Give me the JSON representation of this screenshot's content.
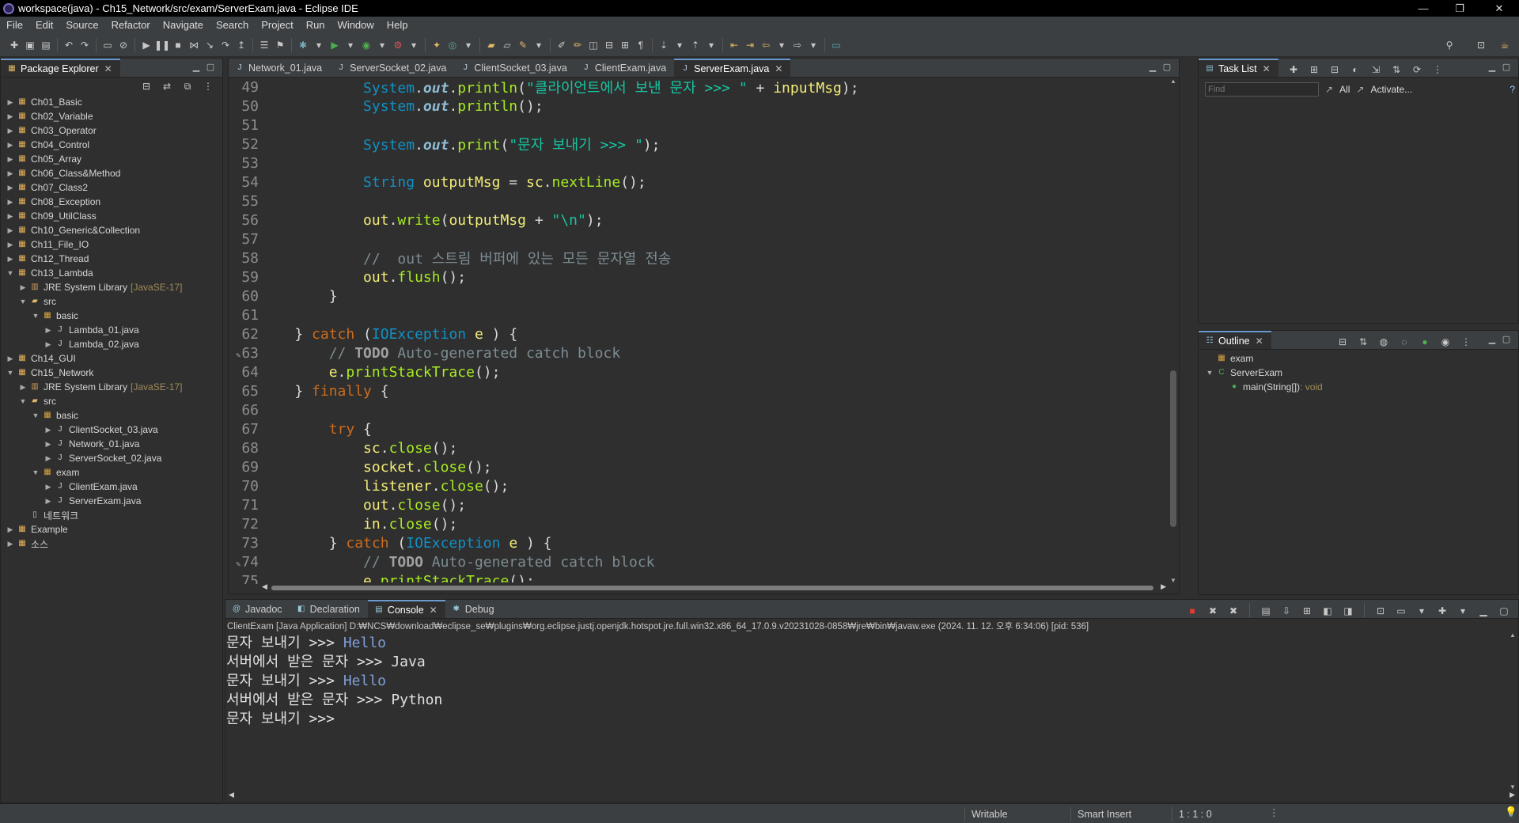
{
  "window": {
    "title": "workspace(java) - Ch15_Network/src/exam/ServerExam.java - Eclipse IDE",
    "minimize": "—",
    "restore": "❐",
    "close": "✕"
  },
  "menu": [
    "File",
    "Edit",
    "Source",
    "Refactor",
    "Navigate",
    "Search",
    "Project",
    "Run",
    "Window",
    "Help"
  ],
  "package_explorer": {
    "tab": "Package Explorer",
    "tree": [
      {
        "label": "Ch01_Basic",
        "level": 0,
        "type": "project",
        "expanded": false
      },
      {
        "label": "Ch02_Variable",
        "level": 0,
        "type": "project",
        "expanded": false
      },
      {
        "label": "Ch03_Operator",
        "level": 0,
        "type": "project",
        "expanded": false
      },
      {
        "label": "Ch04_Control",
        "level": 0,
        "type": "project",
        "expanded": false
      },
      {
        "label": "Ch05_Array",
        "level": 0,
        "type": "project",
        "expanded": false
      },
      {
        "label": "Ch06_Class&Method",
        "level": 0,
        "type": "project",
        "expanded": false
      },
      {
        "label": "Ch07_Class2",
        "level": 0,
        "type": "project",
        "expanded": false
      },
      {
        "label": "Ch08_Exception",
        "level": 0,
        "type": "project",
        "expanded": false
      },
      {
        "label": "Ch09_UtilClass",
        "level": 0,
        "type": "project",
        "expanded": false
      },
      {
        "label": "Ch10_Generic&Collection",
        "level": 0,
        "type": "project",
        "expanded": false
      },
      {
        "label": "Ch11_File_IO",
        "level": 0,
        "type": "project",
        "expanded": false
      },
      {
        "label": "Ch12_Thread",
        "level": 0,
        "type": "project",
        "expanded": false
      },
      {
        "label": "Ch13_Lambda",
        "level": 0,
        "type": "project",
        "expanded": true
      },
      {
        "label": "JRE System Library",
        "suffix": "[JavaSE-17]",
        "level": 1,
        "type": "library",
        "expanded": false
      },
      {
        "label": "src",
        "level": 1,
        "type": "folder",
        "expanded": true
      },
      {
        "label": "basic",
        "level": 2,
        "type": "package",
        "expanded": true
      },
      {
        "label": "Lambda_01.java",
        "level": 3,
        "type": "java",
        "expanded": false
      },
      {
        "label": "Lambda_02.java",
        "level": 3,
        "type": "java",
        "expanded": false
      },
      {
        "label": "Ch14_GUI",
        "level": 0,
        "type": "project",
        "expanded": false
      },
      {
        "label": "Ch15_Network",
        "level": 0,
        "type": "project",
        "expanded": true
      },
      {
        "label": "JRE System Library",
        "suffix": "[JavaSE-17]",
        "level": 1,
        "type": "library",
        "expanded": false
      },
      {
        "label": "src",
        "level": 1,
        "type": "folder",
        "expanded": true
      },
      {
        "label": "basic",
        "level": 2,
        "type": "package",
        "expanded": true
      },
      {
        "label": "ClientSocket_03.java",
        "level": 3,
        "type": "java",
        "expanded": false
      },
      {
        "label": "Network_01.java",
        "level": 3,
        "type": "java",
        "expanded": false
      },
      {
        "label": "ServerSocket_02.java",
        "level": 3,
        "type": "java",
        "expanded": false
      },
      {
        "label": "exam",
        "level": 2,
        "type": "package",
        "expanded": true
      },
      {
        "label": "ClientExam.java",
        "level": 3,
        "type": "java",
        "expanded": false
      },
      {
        "label": "ServerExam.java",
        "level": 3,
        "type": "java",
        "expanded": false
      },
      {
        "label": "네트워크",
        "level": 1,
        "type": "file",
        "expanded": null
      },
      {
        "label": "Example",
        "level": 0,
        "type": "project",
        "expanded": false
      },
      {
        "label": "소스",
        "level": 0,
        "type": "project",
        "expanded": false
      }
    ]
  },
  "editor": {
    "tabs": [
      {
        "label": "Network_01.java",
        "active": false
      },
      {
        "label": "ServerSocket_02.java",
        "active": false
      },
      {
        "label": "ClientSocket_03.java",
        "active": false
      },
      {
        "label": "ClientExam.java",
        "active": false
      },
      {
        "label": "ServerExam.java",
        "active": true
      }
    ],
    "lines": [
      {
        "n": "49",
        "tokens": [
          [
            "",
            "            "
          ],
          [
            "t",
            "System"
          ],
          [
            "",
            "."
          ],
          [
            "f",
            "out"
          ],
          [
            "",
            "."
          ],
          [
            "m",
            "println"
          ],
          [
            "",
            "("
          ],
          [
            "s",
            "\"클라이언트에서 보낸 문자 >>> \""
          ],
          [
            "",
            " + "
          ],
          [
            "v",
            "inputMsg"
          ],
          [
            "",
            ");"
          ]
        ]
      },
      {
        "n": "50",
        "tokens": [
          [
            "",
            "            "
          ],
          [
            "t",
            "System"
          ],
          [
            "",
            "."
          ],
          [
            "f",
            "out"
          ],
          [
            "",
            "."
          ],
          [
            "m",
            "println"
          ],
          [
            "",
            "();"
          ]
        ]
      },
      {
        "n": "51",
        "tokens": []
      },
      {
        "n": "52",
        "tokens": [
          [
            "",
            "            "
          ],
          [
            "t",
            "System"
          ],
          [
            "",
            "."
          ],
          [
            "f",
            "out"
          ],
          [
            "",
            "."
          ],
          [
            "m",
            "print"
          ],
          [
            "",
            "("
          ],
          [
            "s",
            "\"문자 보내기 >>> \""
          ],
          [
            "",
            ");"
          ]
        ]
      },
      {
        "n": "53",
        "tokens": []
      },
      {
        "n": "54",
        "tokens": [
          [
            "",
            "            "
          ],
          [
            "t",
            "String"
          ],
          [
            "",
            " "
          ],
          [
            "v",
            "outputMsg"
          ],
          [
            "",
            " = "
          ],
          [
            "v",
            "sc"
          ],
          [
            "",
            "."
          ],
          [
            "m",
            "nextLine"
          ],
          [
            "",
            "();"
          ]
        ]
      },
      {
        "n": "55",
        "tokens": []
      },
      {
        "n": "56",
        "tokens": [
          [
            "",
            "            "
          ],
          [
            "v",
            "out"
          ],
          [
            "",
            "."
          ],
          [
            "m",
            "write"
          ],
          [
            "",
            "("
          ],
          [
            "v",
            "outputMsg"
          ],
          [
            "",
            " + "
          ],
          [
            "s",
            "\"\\n\""
          ],
          [
            "",
            ");"
          ]
        ]
      },
      {
        "n": "57",
        "tokens": []
      },
      {
        "n": "58",
        "tokens": [
          [
            "",
            "            "
          ],
          [
            "c",
            "//  out 스트림 버퍼에 있는 모든 문자열 전송"
          ]
        ]
      },
      {
        "n": "59",
        "tokens": [
          [
            "",
            "            "
          ],
          [
            "v",
            "out"
          ],
          [
            "",
            "."
          ],
          [
            "m",
            "flush"
          ],
          [
            "",
            "();"
          ]
        ]
      },
      {
        "n": "60",
        "tokens": [
          [
            "",
            "        }"
          ]
        ]
      },
      {
        "n": "61",
        "tokens": []
      },
      {
        "n": "62",
        "tokens": [
          [
            "",
            "    } "
          ],
          [
            "k",
            "catch"
          ],
          [
            "",
            " ("
          ],
          [
            "t",
            "IOException"
          ],
          [
            "",
            " "
          ],
          [
            "v",
            "e"
          ],
          [
            "",
            " ) {"
          ]
        ]
      },
      {
        "n": "63",
        "marker": true,
        "tokens": [
          [
            "",
            "        "
          ],
          [
            "c",
            "// "
          ],
          [
            "kb",
            "TODO"
          ],
          [
            "c",
            " Auto-generated catch block"
          ]
        ]
      },
      {
        "n": "64",
        "tokens": [
          [
            "",
            "        "
          ],
          [
            "v",
            "e"
          ],
          [
            "",
            "."
          ],
          [
            "m",
            "printStackTrace"
          ],
          [
            "",
            "();"
          ]
        ]
      },
      {
        "n": "65",
        "tokens": [
          [
            "",
            "    } "
          ],
          [
            "k",
            "finally"
          ],
          [
            "",
            " {"
          ]
        ]
      },
      {
        "n": "66",
        "tokens": []
      },
      {
        "n": "67",
        "tokens": [
          [
            "",
            "        "
          ],
          [
            "k",
            "try"
          ],
          [
            "",
            " {"
          ]
        ]
      },
      {
        "n": "68",
        "tokens": [
          [
            "",
            "            "
          ],
          [
            "v",
            "sc"
          ],
          [
            "",
            "."
          ],
          [
            "m",
            "close"
          ],
          [
            "",
            "();"
          ]
        ]
      },
      {
        "n": "69",
        "tokens": [
          [
            "",
            "            "
          ],
          [
            "v",
            "socket"
          ],
          [
            "",
            "."
          ],
          [
            "m",
            "close"
          ],
          [
            "",
            "();"
          ]
        ]
      },
      {
        "n": "70",
        "tokens": [
          [
            "",
            "            "
          ],
          [
            "v",
            "listener"
          ],
          [
            "",
            "."
          ],
          [
            "m",
            "close"
          ],
          [
            "",
            "();"
          ]
        ]
      },
      {
        "n": "71",
        "tokens": [
          [
            "",
            "            "
          ],
          [
            "v",
            "out"
          ],
          [
            "",
            "."
          ],
          [
            "m",
            "close"
          ],
          [
            "",
            "();"
          ]
        ]
      },
      {
        "n": "72",
        "tokens": [
          [
            "",
            "            "
          ],
          [
            "v",
            "in"
          ],
          [
            "",
            "."
          ],
          [
            "m",
            "close"
          ],
          [
            "",
            "();"
          ]
        ]
      },
      {
        "n": "73",
        "tokens": [
          [
            "",
            "        } "
          ],
          [
            "k",
            "catch"
          ],
          [
            "",
            " ("
          ],
          [
            "t",
            "IOException"
          ],
          [
            "",
            " "
          ],
          [
            "v",
            "e"
          ],
          [
            "",
            " ) {"
          ]
        ]
      },
      {
        "n": "74",
        "marker": true,
        "tokens": [
          [
            "",
            "            "
          ],
          [
            "c",
            "// "
          ],
          [
            "kb",
            "TODO"
          ],
          [
            "c",
            " Auto-generated catch block"
          ]
        ]
      },
      {
        "n": "75",
        "tokens": [
          [
            "",
            "            "
          ],
          [
            "v",
            "e"
          ],
          [
            "",
            "."
          ],
          [
            "m",
            "printStackTrace"
          ],
          [
            "",
            "();"
          ]
        ]
      }
    ]
  },
  "tasklist": {
    "tab": "Task List",
    "find_placeholder": "Find",
    "all": "All",
    "activate": "Activate..."
  },
  "outline": {
    "tab": "Outline",
    "items": [
      {
        "label": "exam",
        "level": 0,
        "kind": "package"
      },
      {
        "label": "ServerExam",
        "level": 0,
        "kind": "class",
        "expanded": true
      },
      {
        "label": "main(String[])",
        "suffix": " : void",
        "level": 1,
        "kind": "method"
      }
    ]
  },
  "bottom": {
    "tabs": [
      {
        "label": "Javadoc",
        "icon": "@",
        "active": false
      },
      {
        "label": "Declaration",
        "icon": "◧",
        "active": false
      },
      {
        "label": "Console",
        "icon": "▤",
        "active": true
      },
      {
        "label": "Debug",
        "icon": "✱",
        "active": false
      }
    ],
    "console_header": "ClientExam [Java Application] D:₩NCS₩download₩eclipse_se₩plugins₩org.eclipse.justj.openjdk.hotspot.jre.full.win32.x86_64_17.0.9.v20231028-0858₩jre₩bin₩javaw.exe  (2024. 11. 12. 오후 6:34:06) [pid: 536]",
    "lines": [
      {
        "prompt": "문자 보내기 >>> ",
        "input": "Hello"
      },
      {
        "prompt": "서버에서 받은 문자 >>> Java",
        "input": ""
      },
      {
        "prompt": "문자 보내기 >>> ",
        "input": "Hello"
      },
      {
        "prompt": "서버에서 받은 문자 >>> Python",
        "input": ""
      },
      {
        "prompt": "문자 보내기 >>> ",
        "input": ""
      }
    ]
  },
  "status": {
    "writable": "Writable",
    "insert_mode": "Smart Insert",
    "position": "1 : 1 : 0"
  }
}
